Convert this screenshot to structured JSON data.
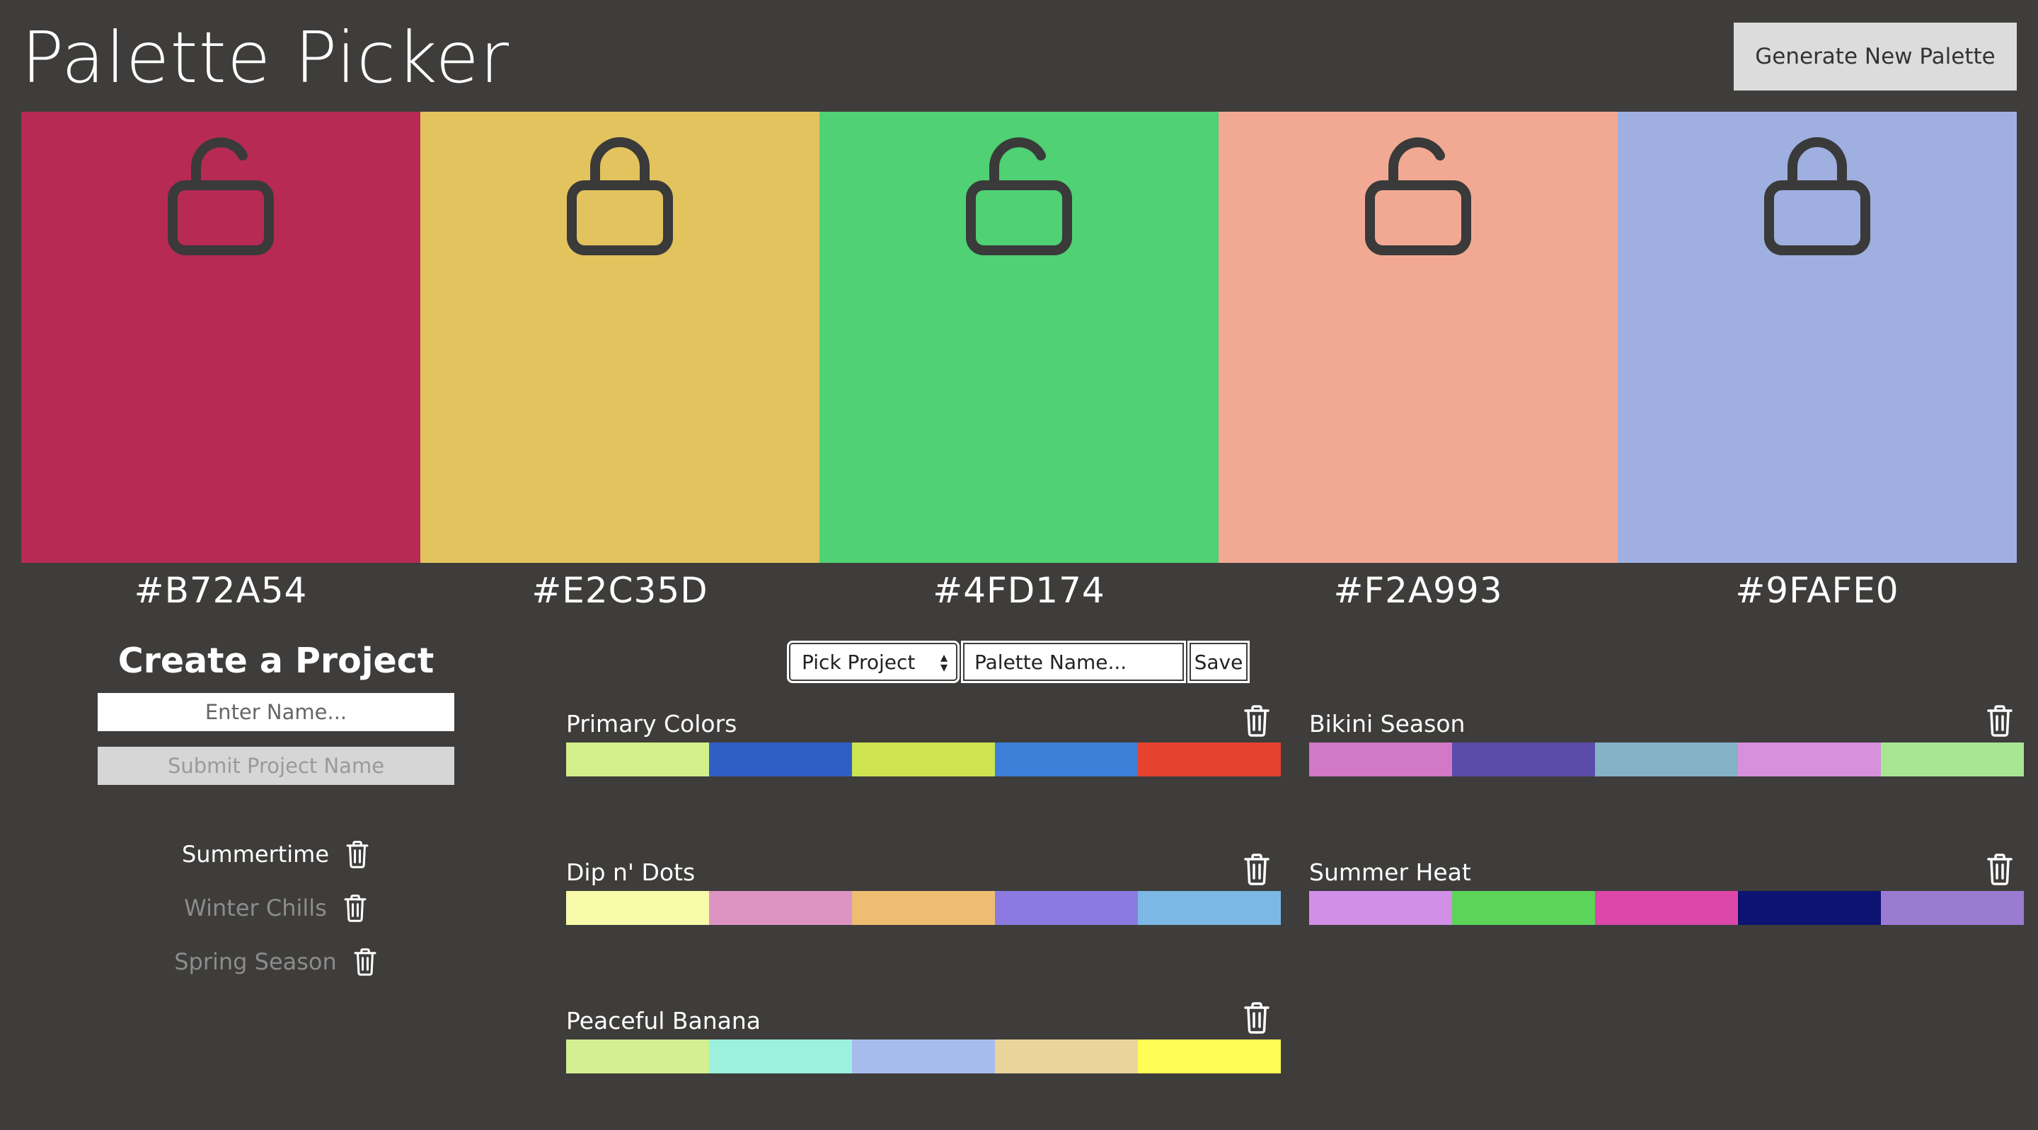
{
  "app": {
    "title": "Palette Picker",
    "generate_label": "Generate New Palette"
  },
  "current_palette": [
    {
      "hex": "#B72A54",
      "color": "#b72a54",
      "locked": false
    },
    {
      "hex": "#E2C35D",
      "color": "#e2c35d",
      "locked": true
    },
    {
      "hex": "#4FD174",
      "color": "#4fd174",
      "locked": false
    },
    {
      "hex": "#F2A993",
      "color": "#f2a993",
      "locked": false
    },
    {
      "hex": "#9FAFE0",
      "color": "#9fafe0",
      "locked": true
    }
  ],
  "create_project": {
    "title": "Create a Project",
    "name_placeholder": "Enter Name...",
    "submit_label": "Submit Project Name"
  },
  "projects": [
    {
      "name": "Summertime",
      "active": true
    },
    {
      "name": "Winter Chills",
      "active": false
    },
    {
      "name": "Spring Season",
      "active": false
    }
  ],
  "save_controls": {
    "select_label": "Pick Project",
    "palette_name_placeholder": "Palette Name...",
    "save_label": "Save"
  },
  "saved_palettes": [
    {
      "name": "Primary Colors",
      "colors": [
        "#d3ef8b",
        "#2f5fc4",
        "#cde350",
        "#3e7fd9",
        "#e5432f"
      ]
    },
    {
      "name": "Bikini Season",
      "colors": [
        "#d178c6",
        "#5a4ca8",
        "#85b2c7",
        "#d690dc",
        "#a8e693"
      ]
    },
    {
      "name": "Dip n' Dots",
      "colors": [
        "#f8fcaa",
        "#dd93c2",
        "#eebd72",
        "#8b7be0",
        "#7bb8e6"
      ]
    },
    {
      "name": "Summer Heat",
      "colors": [
        "#d28fe8",
        "#5cd45a",
        "#dc47aa",
        "#0c1370",
        "#9a7bd2"
      ]
    },
    {
      "name": "Peaceful Banana",
      "colors": [
        "#d2ef92",
        "#9cf0de",
        "#a7bcec",
        "#ebd39c",
        "#fffe54"
      ]
    }
  ],
  "colors": {
    "background": "#3e3d3b",
    "lock_stroke": "#3a3a3a",
    "muted_text": "#8c8c8c"
  }
}
